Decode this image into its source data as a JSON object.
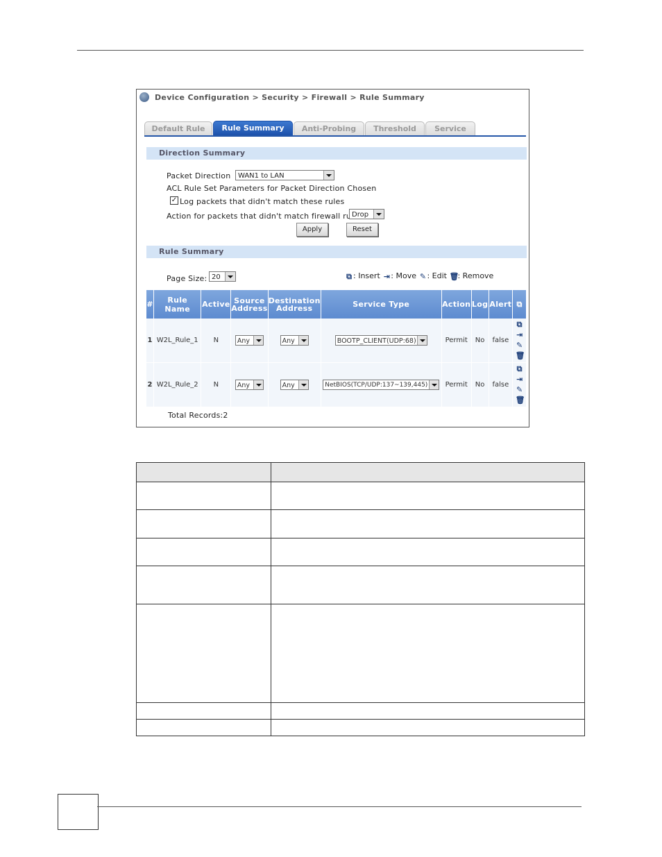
{
  "breadcrumb": "Device Configuration > Security > Firewall > Rule Summary",
  "tabs": [
    {
      "label": "Default Rule",
      "active": false
    },
    {
      "label": "Rule Summary",
      "active": true
    },
    {
      "label": "Anti-Probing",
      "active": false
    },
    {
      "label": "Threshold",
      "active": false
    },
    {
      "label": "Service",
      "active": false
    }
  ],
  "direction_summary": {
    "title": "Direction Summary",
    "packet_direction_label": "Packet Direction",
    "packet_direction_value": "WAN1 to LAN",
    "acl_text": "ACL Rule Set Parameters for Packet Direction Chosen",
    "log_checked": true,
    "log_label": "Log packets that didn't match these rules",
    "action_label": "Action for packets that didn't match firewall rules",
    "action_value": "Drop",
    "apply_label": "Apply",
    "reset_label": "Reset"
  },
  "rule_summary": {
    "title": "Rule Summary",
    "page_size_label": "Page Size:",
    "page_size_value": "20",
    "legend": {
      "insert": ": Insert",
      "move": ": Move",
      "edit": ": Edit",
      "remove": ": Remove"
    },
    "columns": [
      "#",
      "Rule Name",
      "Active",
      "Source Address",
      "Destination Address",
      "Service Type",
      "Action",
      "Log",
      "Alert"
    ],
    "rows": [
      {
        "num": "1",
        "name": "W2L_Rule_1",
        "active": "N",
        "source": "Any",
        "destination": "Any",
        "service": "BOOTP_CLIENT(UDP:68)",
        "action": "Permit",
        "log": "No",
        "alert": "false"
      },
      {
        "num": "2",
        "name": "W2L_Rule_2",
        "active": "N",
        "source": "Any",
        "destination": "Any",
        "service": "NetBIOS(TCP/UDP:137~139,445)",
        "action": "Permit",
        "log": "No",
        "alert": "false"
      }
    ],
    "total_records": "Total Records:2"
  },
  "colors": {
    "tab_active": "#1b4fa9",
    "section_bar": "#d4e4f6",
    "table_header": "#5d8bd0",
    "row_bg": "#f2f6fb"
  }
}
